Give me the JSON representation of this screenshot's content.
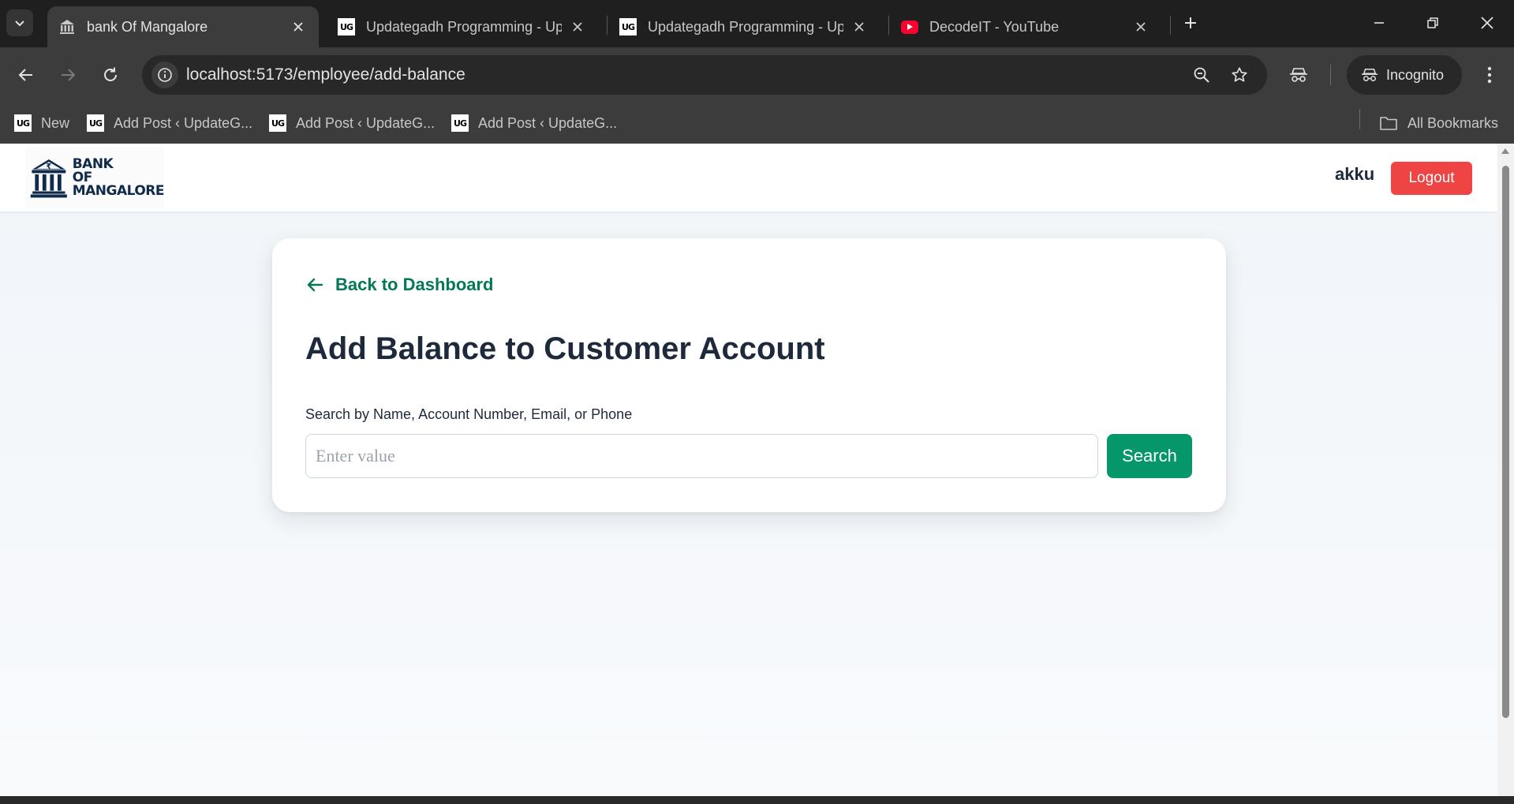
{
  "browser": {
    "tabs": [
      {
        "title": "bank Of Mangalore",
        "active": true,
        "favicon": "bank-favicon"
      },
      {
        "title": "Updategadh Programming - Up",
        "active": false,
        "favicon": "ug-favicon"
      },
      {
        "title": "Updategadh Programming - Up",
        "active": false,
        "favicon": "ug-favicon"
      },
      {
        "title": "DecodeIT - YouTube",
        "active": false,
        "favicon": "youtube-favicon"
      }
    ],
    "ug_badge": "UG",
    "url": "localhost:5173/employee/add-balance",
    "incognito_label": "Incognito",
    "bookmarks": [
      {
        "label": "New",
        "favicon": "ug-favicon"
      },
      {
        "label": "Add Post ‹ UpdateG...",
        "favicon": "ug-favicon"
      },
      {
        "label": "Add Post ‹ UpdateG...",
        "favicon": "ug-favicon"
      },
      {
        "label": "Add Post ‹ UpdateG...",
        "favicon": "ug-favicon"
      }
    ],
    "all_bookmarks_label": "All Bookmarks"
  },
  "header": {
    "logo_lines": [
      "BANK",
      "OF",
      "MANGALORE"
    ],
    "logo_symbol": "₹",
    "username": "akku",
    "logout_label": "Logout"
  },
  "main": {
    "back_label": "Back to Dashboard",
    "title": "Add Balance to Customer Account",
    "search_label": "Search by Name, Account Number, Email, or Phone",
    "search_placeholder": "Enter value",
    "search_value": "",
    "search_button": "Search"
  },
  "colors": {
    "brand_navy": "#0f2a4a",
    "accent_green": "#059669",
    "link_green": "#047857",
    "logout_red": "#ef4444"
  }
}
